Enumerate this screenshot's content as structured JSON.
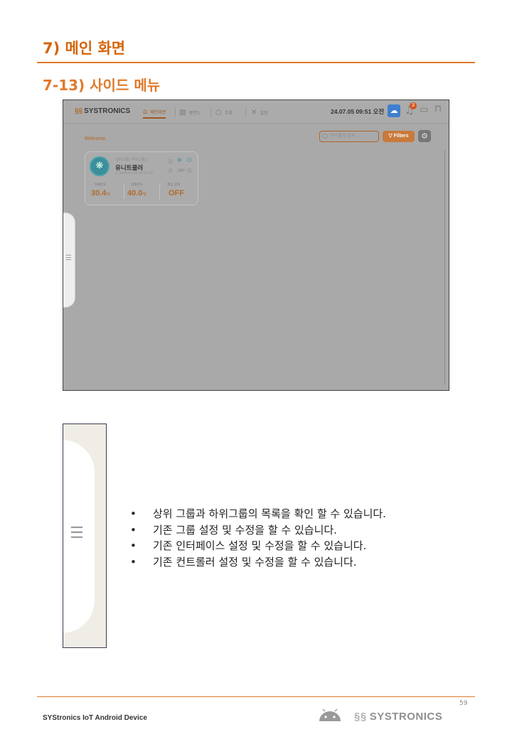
{
  "section_title": "7) 메인 화면",
  "subsection_title": "7-13) 사이드 메뉴",
  "app": {
    "logo_mark": "§§",
    "logo_text": "SYSTRONICS",
    "nav": [
      {
        "label": "메인화면",
        "icon": "home-icon",
        "glyph": "⌂",
        "active": true
      },
      {
        "label": "평면도",
        "icon": "floorplan-icon",
        "glyph": "▧",
        "active": false
      },
      {
        "label": "조회",
        "icon": "search-icon",
        "glyph": "○",
        "active": false
      },
      {
        "label": "설정",
        "icon": "tools-icon",
        "glyph": "✕",
        "active": false
      }
    ],
    "datetime": "24.07.05 09:51 오전",
    "notification_count": "3",
    "welcome": "Welcome,",
    "search_placeholder": "컨트롤러 검색...",
    "filters_label": "Filters",
    "card": {
      "group": "상위그룹1 하위그룹1",
      "name": "유니트쿨러",
      "date": "2024-07-05 09:51:00",
      "metrics": [
        {
          "label": "현재온도",
          "value": "30.4",
          "unit": "°C"
        },
        {
          "label": "설정온도",
          "value": "40.0",
          "unit": "°C"
        },
        {
          "label": "제상 상태",
          "value": "OFF",
          "unit": ""
        }
      ]
    }
  },
  "bullets": [
    "상위 그룹과 하위그룹의 목록을 확인 할 수 있습니다.",
    "기존 그룹 설정 및 수정을 할 수 있습니다.",
    "기존 인터페이스 설정 및 수정을 할 수 있습니다.",
    "기존 컨트롤러 설정 및 수정을 할 수 있습니다."
  ],
  "footer": {
    "left": "SYStronics IoT Android Device",
    "page_number": "59",
    "brand_mark": "§§",
    "brand": "SYSTRONICS"
  },
  "colors": {
    "accent": "#e07a2b",
    "overlay": "#a9a9a9"
  }
}
